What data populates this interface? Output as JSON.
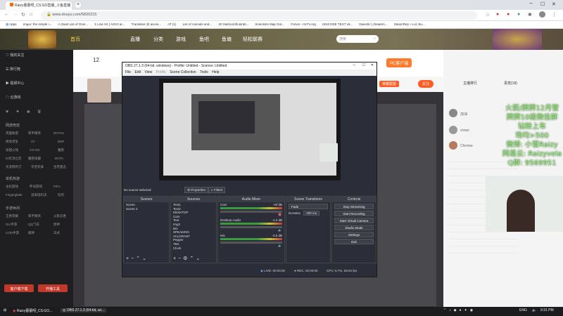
{
  "browser": {
    "tabs": [
      {
        "label": "Raizy蕾蕾呀_CS:GO直播_斗鱼直播"
      }
    ],
    "new_tab_icon": "plus-icon",
    "url": "www.douyu.com/5820215",
    "apps_label": "Apps",
    "bookmarks": [
      "Imgur: the simple i...",
      "A Giant List of Over...",
      "1 Line Art | ASCII ar...",
      "Translator @ asciio...",
      "AT (1)",
      "List of Animals and...",
      "20 Satirical Illustrati...",
      "Scientists Map Out...",
      "Forum - HLTV.org",
      "UNICODE TEXT v6...",
      "Dave2k | cheaters...",
      "SteamRep » Lol, Bu..."
    ]
  },
  "douyu": {
    "nav": [
      "首页",
      "直播",
      "分类",
      "游戏",
      "鱼吧",
      "鱼塘",
      "轻松联赛"
    ],
    "search_placeholder": "搜索",
    "sidebar": {
      "top_items": [
        "我的关注",
        "排行榜",
        "视频中心",
        "云游戏"
      ],
      "sections": [
        {
          "title": "网游竞技",
          "items": [
            "英雄联盟",
            "和平精英",
            "DOTA2",
            "绝地求生",
            "CF",
            "DNF",
            "穿越火线",
            "CS:GO",
            "魔兽",
            "lol云顶之弈",
            "魔兽争霸",
            "DOTA",
            "天涯明月刀",
            "守望先锋",
            "生死狙击"
          ]
        },
        {
          "title": "单机热游",
          "items": [
            "主机游戏",
            "怀旧游戏",
            "Fingerglider",
            "FIFA",
            "逃离塔科夫",
            "吃鸡"
          ]
        },
        {
          "title": "手游休闲",
          "items": [
            "王者荣耀",
            "和平精英",
            "火影忍者",
            "OL/手游",
            "QQ飞车",
            "原神",
            "COD手游",
            "棋牌",
            "日式"
          ]
        }
      ],
      "buttons": [
        "客户端下载",
        "开播工具"
      ]
    },
    "room": {
      "level": "12",
      "follow_label": "关注",
      "tag": "英雄联盟"
    },
    "chat": {
      "title": "主播排行",
      "fans": "贵宾(18)",
      "users": [
        "加油",
        "vivian",
        "Chrome"
      ]
    },
    "overlay_lines": [
      "火箭/牌牌12月管",
      "牌牌10级微信群",
      "钻粉上车",
      "场均>500",
      "微博: 小雪Raizy",
      "网易云: Raizyvela",
      "Q群: 9569951"
    ],
    "pc_badge": "PC客户端"
  },
  "obs": {
    "title": "OBS 27.1.3 (64-bit, windows) - Profile: Untitled - Scenes: Untitled",
    "menu": [
      "File",
      "Edit",
      "View",
      "Profile",
      "Scene Collection",
      "Tools",
      "Help"
    ],
    "no_source": "No source selected",
    "properties_label": "Properties",
    "filters_label": "Filters",
    "scenes_title": "Scenes",
    "scenes": [
      "Scene",
      "Scene 2"
    ],
    "sources_title": "Sources",
    "sources": [
      "Text1",
      "Text2",
      "DESKTOP",
      "Cam",
      "Text",
      "Img2",
      "BG",
      "SPEAKING",
      "VALORANT",
      "Pepper",
      "TBA",
      "Clock"
    ],
    "mixer_title": "Audio Mixer",
    "mixer": [
      {
        "name": "Cam",
        "db": "-inf dB"
      },
      {
        "name": "Desktop Audio",
        "db": "-1.0 dB"
      },
      {
        "name": "Mic",
        "db": "-3.5 dB"
      }
    ],
    "transitions_title": "Scene Transitions",
    "transition": "Fade",
    "duration_label": "Duration",
    "duration": "300 ms",
    "controls_title": "Controls",
    "controls": [
      "Stop Streaming",
      "Start Recording",
      "Start Virtual Camera",
      "Studio Mode",
      "Settings",
      "Exit"
    ],
    "status": {
      "live": "LIVE: 00:00:00",
      "rec": "REC: 00:00:00",
      "cpu": "CPU: 5.7%, 59.94 fps"
    }
  },
  "taskbar": {
    "items": [
      "Raizy蕾蕾呀_CS:GO...",
      "OBS 27.1.3 (64-bit, wi..."
    ],
    "lang": "ENG",
    "time": "9:31 PM"
  }
}
